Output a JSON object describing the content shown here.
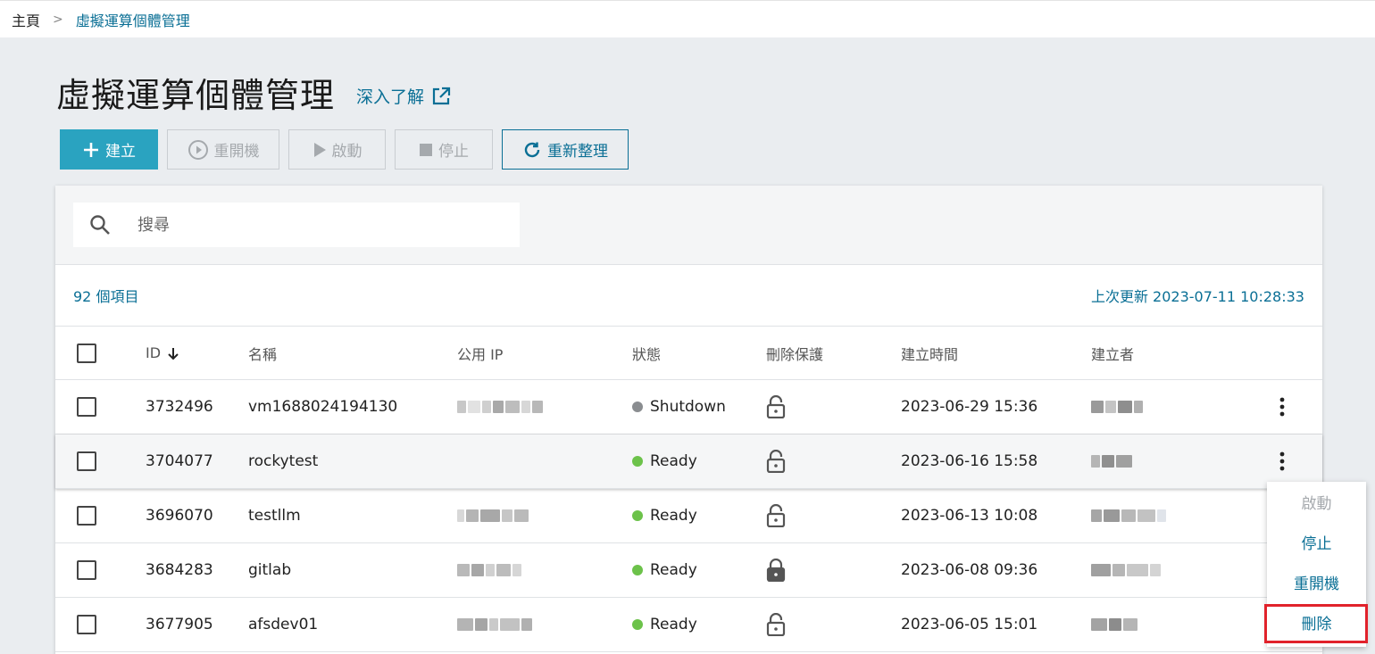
{
  "breadcrumb": {
    "home": "主頁",
    "separator": ">",
    "current": "虛擬運算個體管理"
  },
  "page": {
    "title": "虛擬運算個體管理",
    "learn_more": "深入了解"
  },
  "toolbar": {
    "create": "建立",
    "restart": "重開機",
    "start": "啟動",
    "stop": "停止",
    "refresh": "重新整理"
  },
  "search": {
    "placeholder": "搜尋"
  },
  "meta": {
    "count": "92 個項目",
    "last_update": "上次更新 2023-07-11 10:28:33"
  },
  "table": {
    "headers": {
      "id": "ID",
      "name": "名稱",
      "ip": "公用 IP",
      "status": "狀態",
      "protect": "刪除保護",
      "created": "建立時間",
      "creator": "建立者"
    },
    "rows": [
      {
        "id": "3732496",
        "name": "vm1688024194130",
        "status": "Shutdown",
        "status_color": "#8a8d90",
        "locked": false,
        "created": "2023-06-29 15:36"
      },
      {
        "id": "3704077",
        "name": "rockytest",
        "status": "Ready",
        "status_color": "#6cc24a",
        "locked": false,
        "created": "2023-06-16 15:58"
      },
      {
        "id": "3696070",
        "name": "testllm",
        "status": "Ready",
        "status_color": "#6cc24a",
        "locked": false,
        "created": "2023-06-13 10:08"
      },
      {
        "id": "3684283",
        "name": "gitlab",
        "status": "Ready",
        "status_color": "#6cc24a",
        "locked": true,
        "created": "2023-06-08 09:36"
      },
      {
        "id": "3677905",
        "name": "afsdev01",
        "status": "Ready",
        "status_color": "#6cc24a",
        "locked": false,
        "created": "2023-06-05 15:01"
      }
    ]
  },
  "context_menu": {
    "start": "啟動",
    "stop": "停止",
    "restart": "重開機",
    "delete": "刪除"
  },
  "colors": {
    "accent": "#0a6f95",
    "primary_button": "#2aa3c0",
    "highlight": "#e1222b"
  }
}
